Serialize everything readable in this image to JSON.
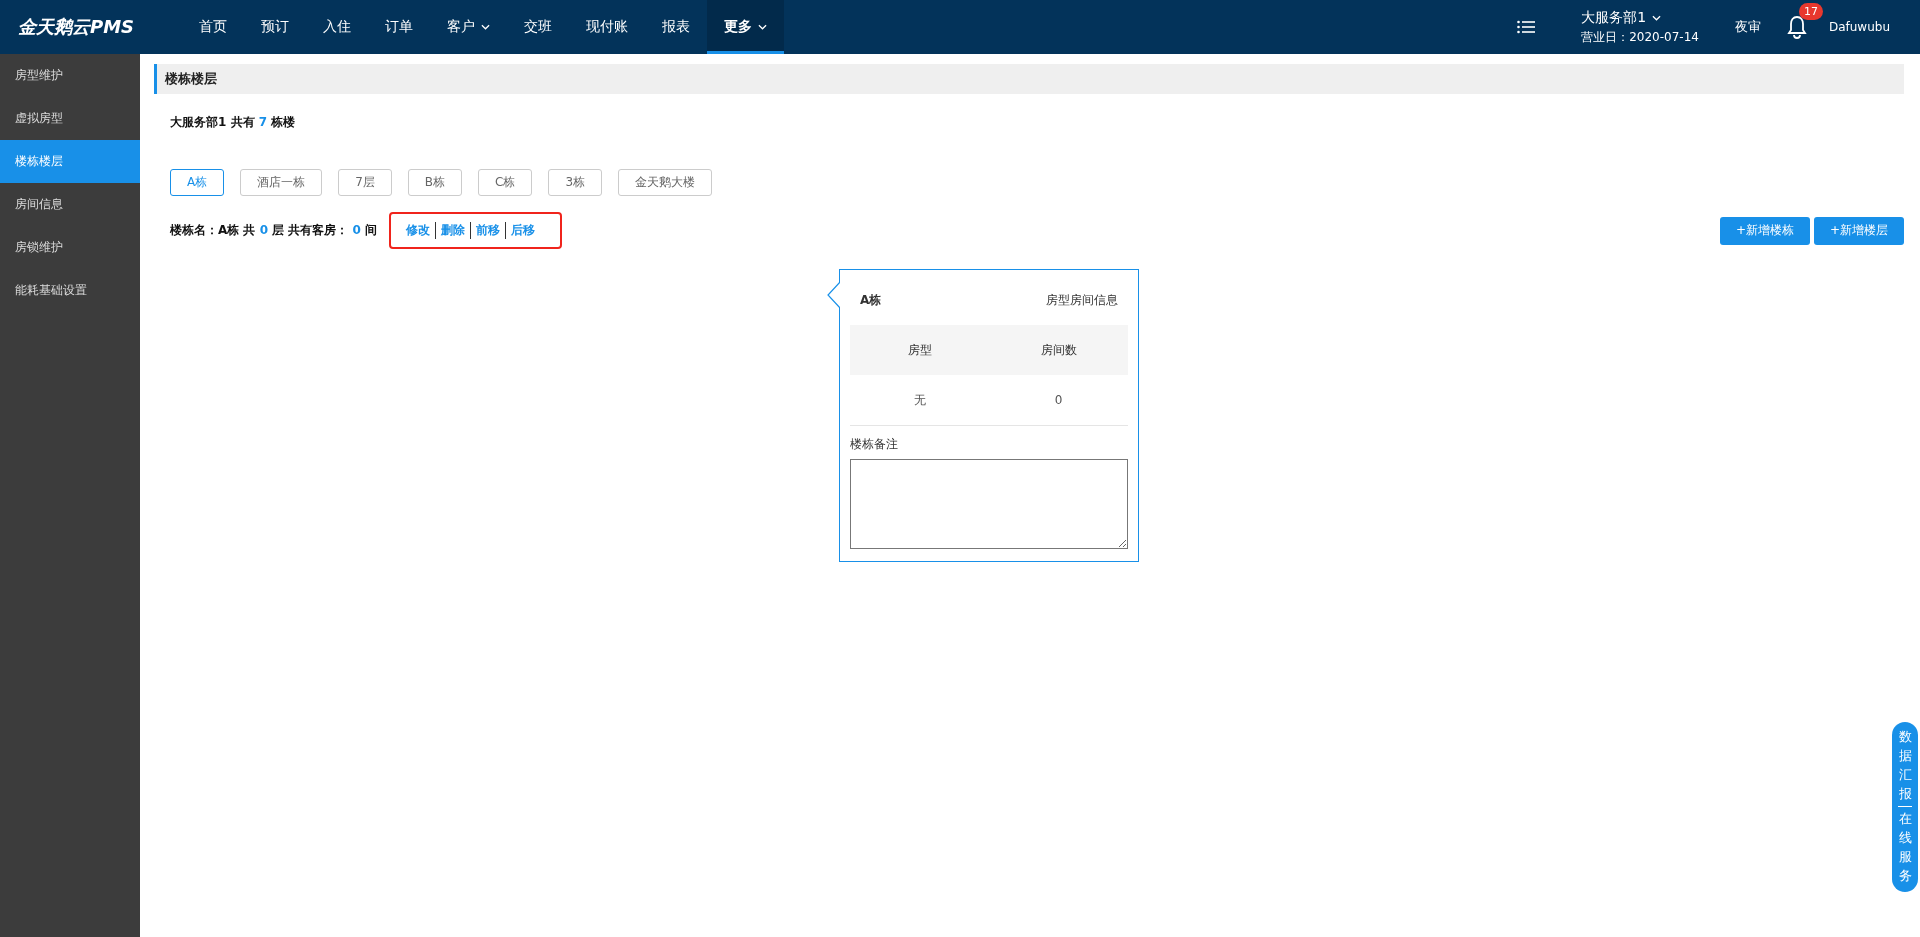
{
  "brand": "金天鹅云PMS",
  "nav": [
    {
      "label": "首页",
      "dropdown": false,
      "selected": false
    },
    {
      "label": "预订",
      "dropdown": false,
      "selected": false
    },
    {
      "label": "入住",
      "dropdown": false,
      "selected": false
    },
    {
      "label": "订单",
      "dropdown": false,
      "selected": false
    },
    {
      "label": "客户",
      "dropdown": true,
      "selected": false
    },
    {
      "label": "交班",
      "dropdown": false,
      "selected": false
    },
    {
      "label": "现付账",
      "dropdown": false,
      "selected": false
    },
    {
      "label": "报表",
      "dropdown": false,
      "selected": false
    },
    {
      "label": "更多",
      "dropdown": true,
      "selected": true
    }
  ],
  "header_right": {
    "store": "大服务部1",
    "business_date": "营业日：2020-07-14",
    "night_audit": "夜审",
    "notifications": "17",
    "user": "Dafuwubu"
  },
  "sidebar": {
    "items": [
      {
        "label": "房型维护",
        "selected": false
      },
      {
        "label": "虚拟房型",
        "selected": false
      },
      {
        "label": "楼栋楼层",
        "selected": true
      },
      {
        "label": "房间信息",
        "selected": false
      },
      {
        "label": "房锁维护",
        "selected": false
      },
      {
        "label": "能耗基础设置",
        "selected": false
      }
    ]
  },
  "page_title": "楼栋楼层",
  "summary": [
    {
      "text": "大服务部1 共有 ",
      "emphasis": false
    },
    {
      "text": "7",
      "emphasis": true
    },
    {
      "text": " 栋楼",
      "emphasis": false
    }
  ],
  "buildings": [
    {
      "label": "A栋",
      "selected": true
    },
    {
      "label": "酒店一栋",
      "selected": false
    },
    {
      "label": "7层",
      "selected": false
    },
    {
      "label": "B栋",
      "selected": false
    },
    {
      "label": "C栋",
      "selected": false
    },
    {
      "label": "3栋",
      "selected": false
    },
    {
      "label": "金天鹅大楼",
      "selected": false
    }
  ],
  "building_info": [
    {
      "text": "楼栋名：A栋 共 ",
      "emphasis": false
    },
    {
      "text": "0",
      "emphasis": true
    },
    {
      "text": " 层 共有客房： ",
      "emphasis": false
    },
    {
      "text": "0",
      "emphasis": true
    },
    {
      "text": " 间",
      "emphasis": false
    }
  ],
  "actions": [
    "修改",
    "删除",
    "前移",
    "后移"
  ],
  "buttons": [
    "+新增楼栋",
    "+新增楼层"
  ],
  "popover": {
    "title": "A栋",
    "subtitle": "房型房间信息",
    "columns": [
      "房型",
      "房间数"
    ],
    "rows": [
      [
        "无",
        "0"
      ]
    ],
    "remarks_label": "楼栋备注"
  },
  "side_tabs": [
    "数据汇报",
    "在线服务"
  ]
}
